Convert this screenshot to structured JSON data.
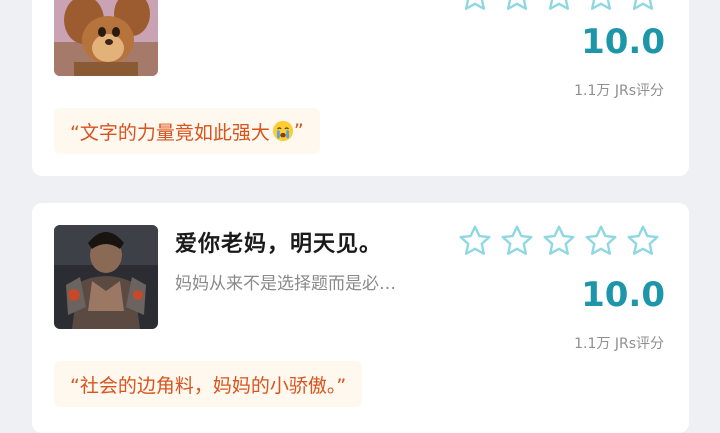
{
  "cards": [
    {
      "title": "",
      "description": "",
      "score": "10.0",
      "rating_count": "1.1万 JRs评分",
      "quote": "“文字的力量竟如此强大",
      "quote_end": "”",
      "quote_emoji": "crying-emoji",
      "thumbnail": "cartoon-mouse-image",
      "star_rating": 0
    },
    {
      "title": "爱你老妈，明天见。",
      "description": "妈妈从来不是选择题而是必…",
      "score": "10.0",
      "rating_count": "1.1万 JRs评分",
      "quote": "“社会的边角料，妈妈的小骄傲。”",
      "thumbnail": "game-character-image",
      "star_rating": 0
    }
  ],
  "colors": {
    "score": "#1c96a8",
    "star_outline": "#8fd7e3",
    "quote_text": "#d9531e",
    "quote_bg": "#fef8ee"
  }
}
